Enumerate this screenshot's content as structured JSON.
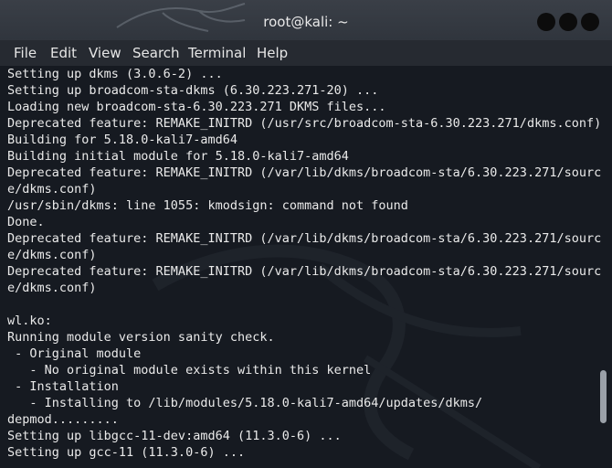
{
  "window": {
    "title": "root@kali: ~"
  },
  "menu": [
    "File",
    "Edit",
    "View",
    "Search",
    "Terminal",
    "Help"
  ],
  "terminal": {
    "lines": [
      "Setting up dkms (3.0.6-2) ...",
      "Setting up broadcom-sta-dkms (6.30.223.271-20) ...",
      "Loading new broadcom-sta-6.30.223.271 DKMS files...",
      "Deprecated feature: REMAKE_INITRD (/usr/src/broadcom-sta-6.30.223.271/dkms.conf)",
      "Building for 5.18.0-kali7-amd64",
      "Building initial module for 5.18.0-kali7-amd64",
      "Deprecated feature: REMAKE_INITRD (/var/lib/dkms/broadcom-sta/6.30.223.271/sourc",
      "e/dkms.conf)",
      "/usr/sbin/dkms: line 1055: kmodsign: command not found",
      "Done.",
      "Deprecated feature: REMAKE_INITRD (/var/lib/dkms/broadcom-sta/6.30.223.271/sourc",
      "e/dkms.conf)",
      "Deprecated feature: REMAKE_INITRD (/var/lib/dkms/broadcom-sta/6.30.223.271/sourc",
      "e/dkms.conf)",
      "",
      "wl.ko:",
      "Running module version sanity check.",
      " - Original module",
      "   - No original module exists within this kernel",
      " - Installation",
      "   - Installing to /lib/modules/5.18.0-kali7-amd64/updates/dkms/",
      "depmod.........",
      "Setting up libgcc-11-dev:amd64 (11.3.0-6) ...",
      "Setting up gcc-11 (11.3.0-6) ..."
    ]
  },
  "scrollbar": {
    "position": 0.76
  }
}
